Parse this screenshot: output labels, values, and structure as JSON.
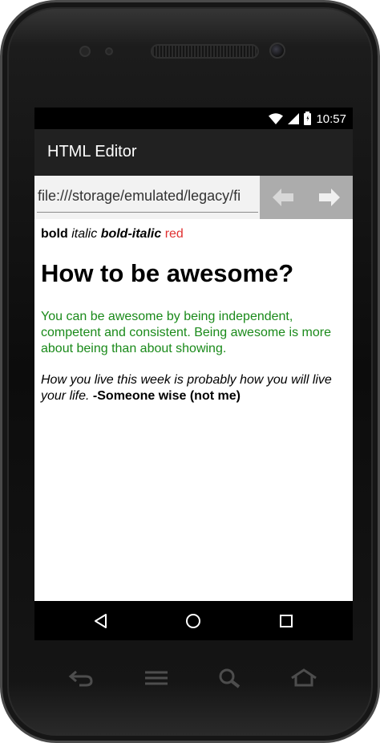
{
  "status_bar": {
    "time": "10:57",
    "icons": [
      "wifi-icon",
      "signal-icon",
      "battery-charging-icon"
    ]
  },
  "action_bar": {
    "title": "HTML Editor"
  },
  "url_bar": {
    "value": "file:///storage/emulated/legacy/fi",
    "back_icon": "arrow-left-icon",
    "forward_icon": "arrow-right-icon"
  },
  "content": {
    "format_line": {
      "bold": "bold",
      "italic": "italic",
      "bold_italic": "bold-italic",
      "red": "red"
    },
    "heading": "How to be awesome?",
    "paragraph": "You can be awesome by being independent, competent and consistent. Being awesome is more about being than about showing.",
    "quote": {
      "text": "How you live this week is probably how you will live your life.",
      "author": "-Someone wise (not me)"
    }
  },
  "system_nav": {
    "back_icon": "triangle-back-icon",
    "home_icon": "circle-home-icon",
    "recents_icon": "square-recents-icon"
  },
  "hardware_keys": [
    "back-key-icon",
    "menu-key-icon",
    "search-key-icon",
    "home-key-icon"
  ],
  "colors": {
    "action_bar": "#212121",
    "nav_buttons_bg": "#acacac",
    "paragraph_green": "#1a8a1a",
    "red_text": "#e03131"
  }
}
